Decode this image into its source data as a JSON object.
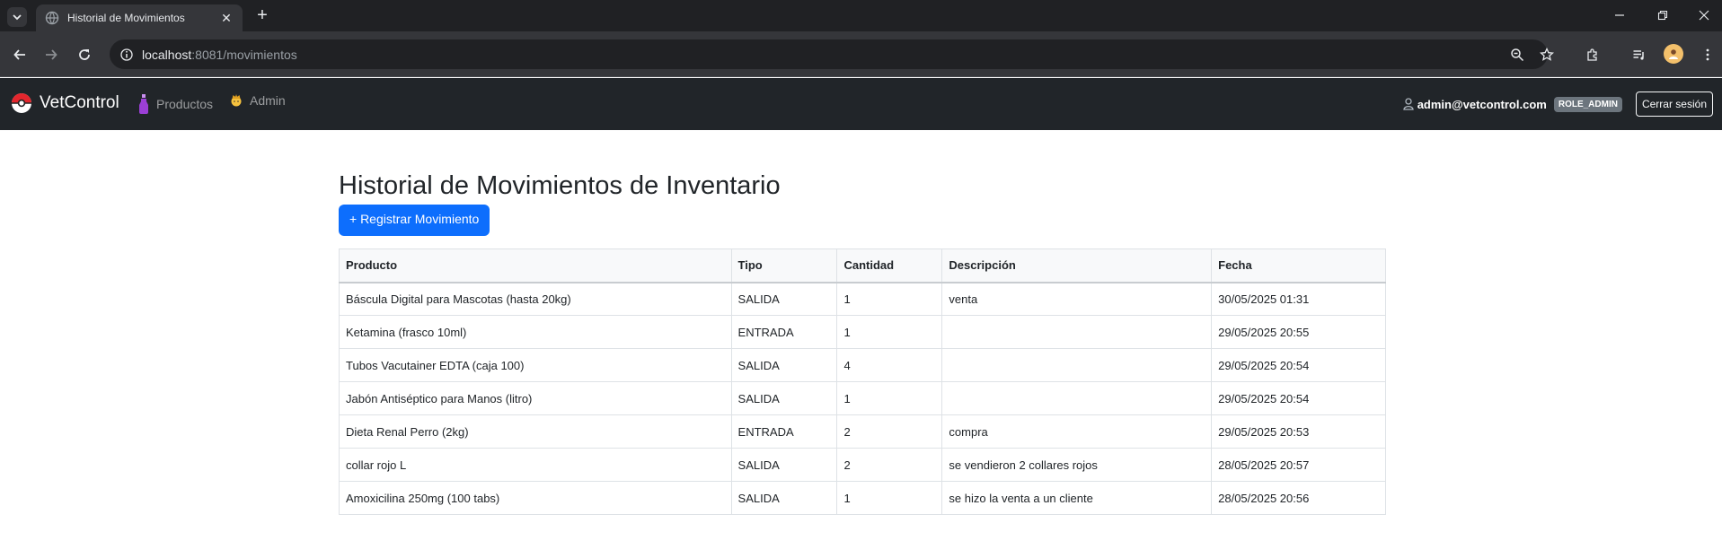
{
  "browser": {
    "tab_title": "Historial de Movimientos",
    "url_host": "localhost",
    "url_rest": ":8081/movimientos"
  },
  "navbar": {
    "brand": "VetControl",
    "links": [
      {
        "label": "Productos",
        "icon": "potion-icon"
      },
      {
        "label": "Admin",
        "icon": "person-icon"
      }
    ],
    "user_email": "admin@vetcontrol.com",
    "role": "ROLE_ADMIN",
    "logout": "Cerrar sesión"
  },
  "page": {
    "title": "Historial de Movimientos de Inventario",
    "register_button": "+ Registrar Movimiento"
  },
  "table": {
    "headers": [
      "Producto",
      "Tipo",
      "Cantidad",
      "Descripción",
      "Fecha"
    ],
    "rows": [
      [
        "Báscula Digital para Mascotas (hasta 20kg)",
        "SALIDA",
        "1",
        "venta",
        "30/05/2025 01:31"
      ],
      [
        "Ketamina (frasco 10ml)",
        "ENTRADA",
        "1",
        "",
        "29/05/2025 20:55"
      ],
      [
        "Tubos Vacutainer EDTA (caja 100)",
        "SALIDA",
        "4",
        "",
        "29/05/2025 20:54"
      ],
      [
        "Jabón Antiséptico para Manos (litro)",
        "SALIDA",
        "1",
        "",
        "29/05/2025 20:54"
      ],
      [
        "Dieta Renal Perro (2kg)",
        "ENTRADA",
        "2",
        "compra",
        "29/05/2025 20:53"
      ],
      [
        "collar rojo L",
        "SALIDA",
        "2",
        "se vendieron 2 collares rojos",
        "28/05/2025 20:57"
      ],
      [
        "Amoxicilina 250mg (100 tabs)",
        "SALIDA",
        "1",
        "se hizo la venta a un cliente",
        "28/05/2025 20:56"
      ]
    ]
  },
  "colors": {
    "navbar_bg": "#212529",
    "primary": "#0d6efd",
    "badge": "#6c757d"
  }
}
